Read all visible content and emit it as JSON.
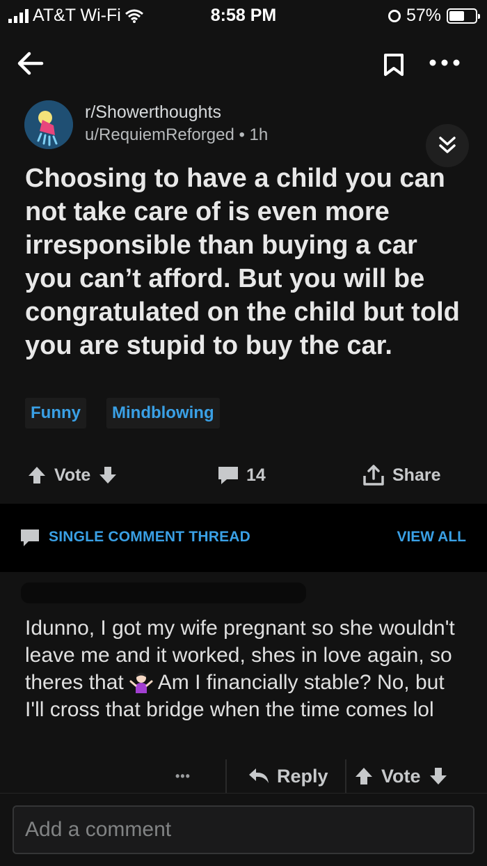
{
  "status_bar": {
    "carrier": "AT&T Wi-Fi",
    "time": "8:58 PM",
    "battery": "57%",
    "battery_level": 0.57
  },
  "post": {
    "subreddit": "r/Showerthoughts",
    "author": "u/RequiemReforged",
    "age": "1h",
    "title": "Choosing to have a child you can not take care of is even more irresponsible than buying a car you can’t afford. But you will be congratulated on the child but told you are stupid to buy the car.",
    "flairs": [
      "Funny",
      "Mindblowing"
    ],
    "actions": {
      "vote": "Vote",
      "comments": "14",
      "share": "Share"
    }
  },
  "thread": {
    "label": "SINGLE COMMENT THREAD",
    "view_all": "VIEW ALL"
  },
  "comment": {
    "text_1": "Idunno, I got my wife pregnant so she wouldn't leave me and it worked, shes in love again, so theres that",
    "text_2": "Am I financially stable? No, but I'll cross that bridge when the time comes lol",
    "more": "•••",
    "reply": "Reply",
    "vote": "Vote"
  },
  "composer": {
    "placeholder": "Add a comment"
  },
  "colors": {
    "background": "#121212",
    "accent_blue": "#3aa0e5",
    "band": "#000000"
  }
}
